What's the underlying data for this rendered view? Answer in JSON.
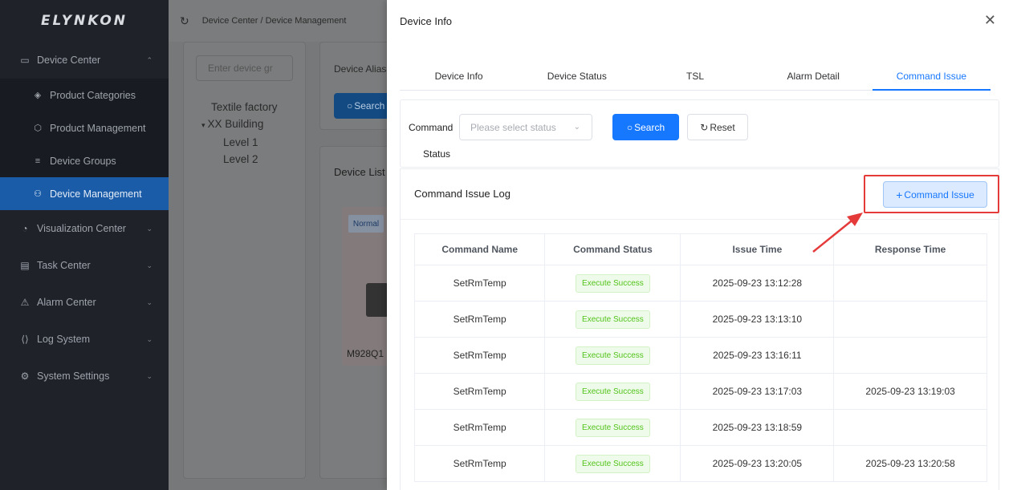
{
  "brand": "ELYNKON",
  "sidebar": {
    "groups": [
      {
        "label": "Device Center",
        "icon": "monitor-icon",
        "expanded": true,
        "items": [
          {
            "label": "Product Categories",
            "icon": "layers-icon",
            "active": false
          },
          {
            "label": "Product Management",
            "icon": "cube-icon",
            "active": false
          },
          {
            "label": "Device Groups",
            "icon": "list-icon",
            "active": false
          },
          {
            "label": "Device Management",
            "icon": "network-icon",
            "active": true
          }
        ]
      },
      {
        "label": "Visualization Center",
        "icon": "chart-icon"
      },
      {
        "label": "Task Center",
        "icon": "clipboard-icon"
      },
      {
        "label": "Alarm Center",
        "icon": "alarm-icon"
      },
      {
        "label": "Log System",
        "icon": "code-icon"
      },
      {
        "label": "System Settings",
        "icon": "gear-icon"
      }
    ]
  },
  "background": {
    "breadcrumb": "Device Center / Device Management",
    "tree_search_placeholder": "Enter device gr",
    "tree": {
      "root": "Textile factory",
      "building": "XX Building",
      "levels": [
        "Level 1",
        "Level 2"
      ]
    },
    "filter_label": "Device Alias",
    "search_label": "Search",
    "list_title": "Device List",
    "card": {
      "badge": "Normal",
      "name": "M928Q1"
    }
  },
  "drawer": {
    "title": "Device Info",
    "tabs": [
      {
        "label": "Device Info",
        "active": false
      },
      {
        "label": "Device Status",
        "active": false
      },
      {
        "label": "TSL",
        "active": false
      },
      {
        "label": "Alarm Detail",
        "active": false
      },
      {
        "label": "Command Issue",
        "active": true
      }
    ],
    "filter": {
      "label_line1": "Command",
      "label_line2": "Status",
      "select_placeholder": "Please select status",
      "search_button": "Search",
      "reset_button": "Reset"
    },
    "log": {
      "title": "Command Issue Log",
      "issue_button": "Command Issue",
      "columns": [
        "Command Name",
        "Command Status",
        "Issue Time",
        "Response Time"
      ],
      "rows": [
        {
          "name": "SetRmTemp",
          "status": "Execute Success",
          "issue_time": "2025-09-23 13:12:28",
          "response_time": ""
        },
        {
          "name": "SetRmTemp",
          "status": "Execute Success",
          "issue_time": "2025-09-23 13:13:10",
          "response_time": ""
        },
        {
          "name": "SetRmTemp",
          "status": "Execute Success",
          "issue_time": "2025-09-23 13:16:11",
          "response_time": ""
        },
        {
          "name": "SetRmTemp",
          "status": "Execute Success",
          "issue_time": "2025-09-23 13:17:03",
          "response_time": "2025-09-23 13:19:03"
        },
        {
          "name": "SetRmTemp",
          "status": "Execute Success",
          "issue_time": "2025-09-23 13:18:59",
          "response_time": ""
        },
        {
          "name": "SetRmTemp",
          "status": "Execute Success",
          "issue_time": "2025-09-23 13:20:05",
          "response_time": "2025-09-23 13:20:58"
        }
      ]
    }
  },
  "colors": {
    "primary": "#1677ff",
    "sidebar_bg": "#1f2229",
    "active_menu": "#1a5ca8",
    "success": "#52c41a",
    "annotation_red": "#e53a3a"
  }
}
